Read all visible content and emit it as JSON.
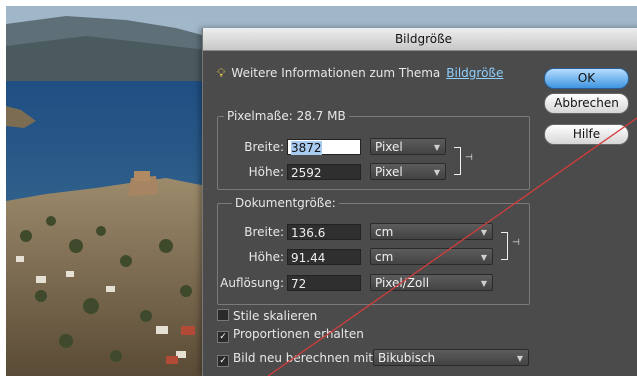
{
  "dialog": {
    "title": "Bildgröße",
    "info_text": "Weitere Informationen zum Thema",
    "info_link": "Bildgröße",
    "buttons": {
      "ok": "OK",
      "cancel": "Abbrechen",
      "help": "Hilfe"
    },
    "pixel_dimensions": {
      "legend": "Pixelmaße: 28.7 MB",
      "width_label": "Breite:",
      "width_value": "3872",
      "width_unit": "Pixel",
      "height_label": "Höhe:",
      "height_value": "2592",
      "height_unit": "Pixel"
    },
    "document_size": {
      "legend": "Dokumentgröße:",
      "width_label": "Breite:",
      "width_value": "136.6",
      "width_unit": "cm",
      "height_label": "Höhe:",
      "height_value": "91.44",
      "height_unit": "cm",
      "resolution_label": "Auflösung:",
      "resolution_value": "72",
      "resolution_unit": "Pixel/Zoll"
    },
    "options": {
      "scale_styles": {
        "label": "Stile skalieren",
        "checked": false
      },
      "constrain": {
        "label": "Proportionen erhalten",
        "checked": true
      },
      "resample": {
        "label": "Bild neu berechnen mit:",
        "checked": true,
        "method": "Bikubisch"
      }
    }
  },
  "colors": {
    "dialog_bg": "#4b4b4b",
    "link": "#8fd0ff",
    "annotation_line": "#d23c3c"
  },
  "icons": {
    "info": "lightbulb-icon",
    "link": "chain-link-icon",
    "dropdown": "chevron-down-icon"
  }
}
